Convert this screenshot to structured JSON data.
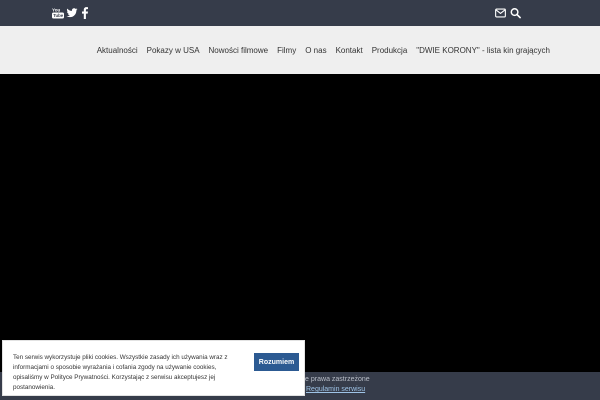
{
  "topbar": {
    "social_icons": [
      "youtube-icon",
      "twitter-icon",
      "facebook-icon"
    ],
    "utility_icons": [
      "mail-icon",
      "search-icon"
    ],
    "background_color": "#363c4a"
  },
  "nav": {
    "items": [
      {
        "label": "Aktualności"
      },
      {
        "label": "Pokazy w USA"
      },
      {
        "label": "Nowości filmowe"
      },
      {
        "label": "Filmy"
      },
      {
        "label": "O nas"
      },
      {
        "label": "Kontakt"
      },
      {
        "label": "Produkcja"
      },
      {
        "label": "\"DWIE KORONY\" - lista kin grających"
      }
    ]
  },
  "footer": {
    "copyright": "kie prawa zastrzeżone",
    "terms_link": "Regulamin serwisu"
  },
  "cookie": {
    "line1": "Ten serwis wykorzystuje pliki cookies. Wszystkie zasady ich używania wraz z",
    "line2": "informacjami o sposobie wyrażania i cofania zgody na używanie cookies,",
    "line3": "opisaliśmy w Polityce Prywatności. Korzystając z serwisu akceptujesz jej postanowienia.",
    "button_label": "Rozumiem",
    "button_color": "#2c5a92"
  }
}
